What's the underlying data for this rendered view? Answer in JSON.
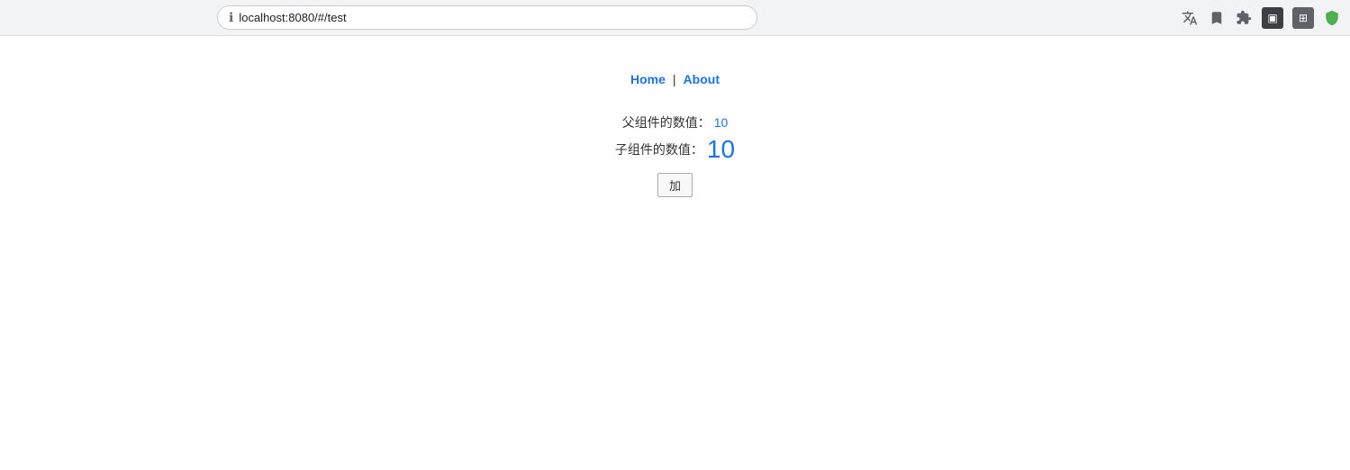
{
  "browser": {
    "address": "localhost:8080/#/test",
    "info_icon": "ℹ",
    "icons": {
      "translate": "译",
      "bookmark": "☆",
      "extension": "⬜",
      "profile": "▣",
      "screenshot": "▦",
      "shield": "🛡"
    }
  },
  "nav": {
    "home_label": "Home",
    "separator": "|",
    "about_label": "About"
  },
  "content": {
    "parent_label": "父组件的数值：",
    "parent_value": "10",
    "child_label": "子组件的数值：",
    "child_value": "10",
    "button_label": "加"
  }
}
